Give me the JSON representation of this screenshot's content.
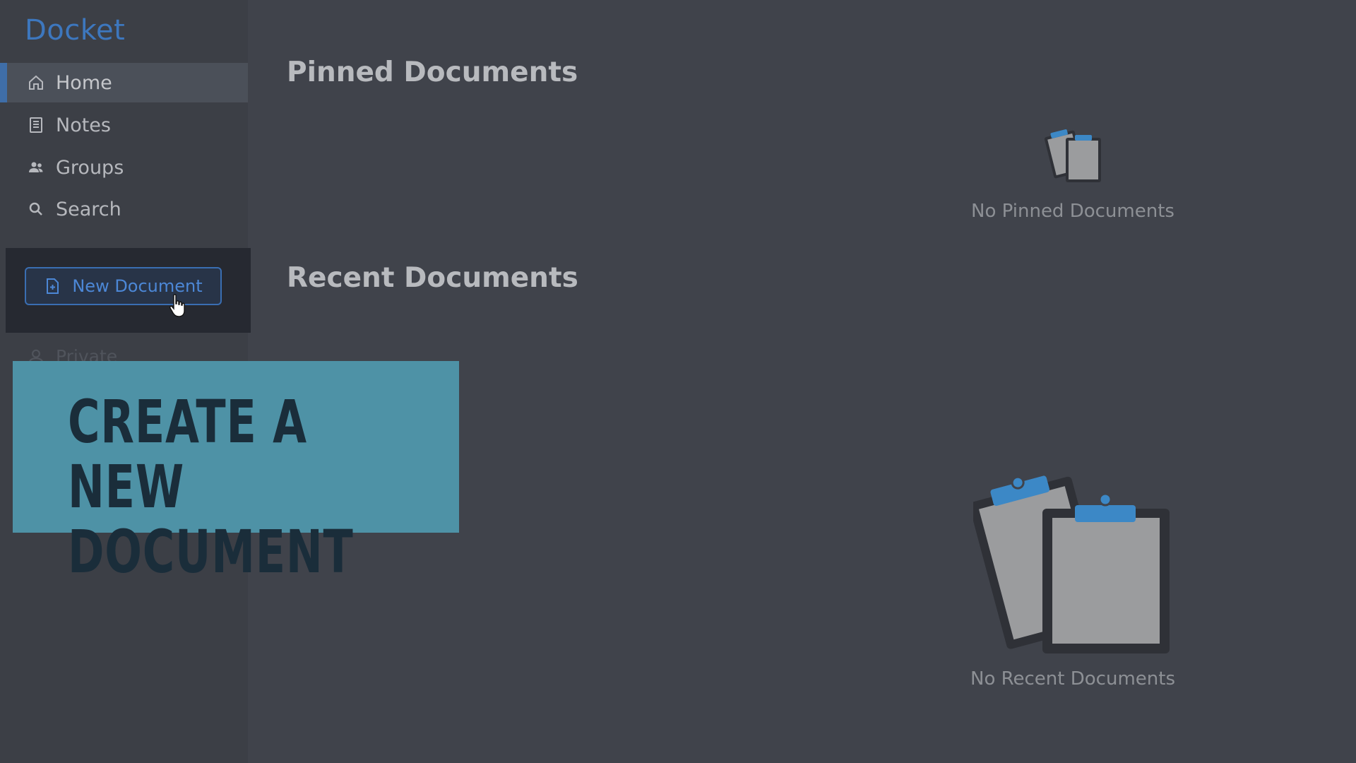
{
  "app": {
    "title": "Docket"
  },
  "sidebar": {
    "items": [
      {
        "label": "Home",
        "icon": "home-icon",
        "active": true
      },
      {
        "label": "Notes",
        "icon": "notes-icon",
        "active": false
      },
      {
        "label": "Groups",
        "icon": "groups-icon",
        "active": false
      },
      {
        "label": "Search",
        "icon": "search-icon",
        "active": false
      }
    ],
    "new_document_label": "New Document",
    "private_label": "Private"
  },
  "banner": {
    "text": "CREATE A NEW\nDOCUMENT"
  },
  "main": {
    "pinned_title": "Pinned Documents",
    "pinned_empty": "No Pinned Documents",
    "recent_title": "Recent Documents",
    "recent_empty": "No Recent Documents"
  },
  "colors": {
    "accent": "#3d77be",
    "background": "#40434b",
    "banner": "#4e92a6"
  }
}
